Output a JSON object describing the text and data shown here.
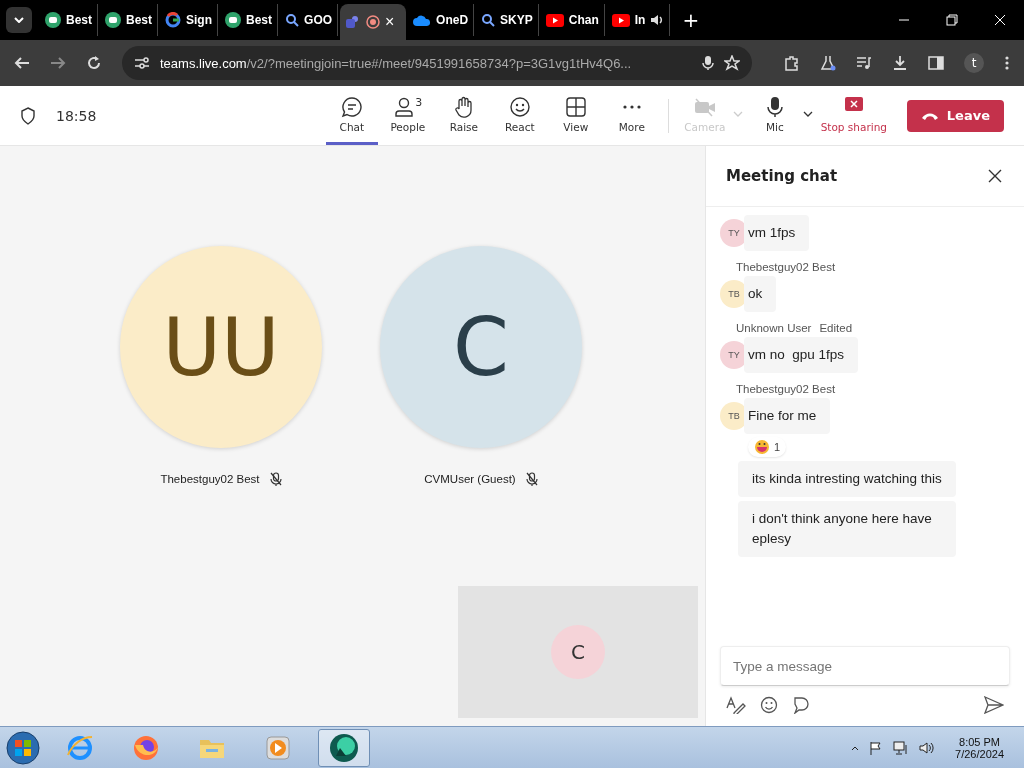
{
  "browser": {
    "tabs": [
      {
        "kind": "green",
        "label": "Best",
        "selected": false,
        "recording": false,
        "audio": false
      },
      {
        "kind": "green",
        "label": "Best",
        "selected": false,
        "recording": false,
        "audio": false
      },
      {
        "kind": "google",
        "label": "Sign",
        "selected": false,
        "recording": false,
        "audio": false
      },
      {
        "kind": "green",
        "label": "Best",
        "selected": false,
        "recording": false,
        "audio": false
      },
      {
        "kind": "search",
        "label": "GOO",
        "selected": false,
        "recording": false,
        "audio": false
      },
      {
        "kind": "teams",
        "selected": true,
        "recording": true,
        "audio": false,
        "close": "×"
      },
      {
        "kind": "cloud",
        "label": "OneD",
        "selected": false,
        "recording": false,
        "audio": false
      },
      {
        "kind": "search",
        "label": "SKYP",
        "selected": false,
        "recording": false,
        "audio": false
      },
      {
        "kind": "youtube",
        "label": "Chan",
        "selected": false,
        "recording": false,
        "audio": false
      },
      {
        "kind": "youtube",
        "label": "In",
        "selected": false,
        "recording": false,
        "audio": true
      }
    ],
    "new_tab": "+",
    "address": {
      "host": "teams.live.com",
      "path": "/v2/?meetingjoin=true#/meet/9451991658734?p=3G1vg1tHv4Q6..."
    },
    "profile": "t"
  },
  "meeting": {
    "time": "18:58",
    "toolbar": [
      {
        "kind": "chat",
        "label": "Chat",
        "selected": true,
        "disabled": false,
        "dropdown": false
      },
      {
        "kind": "people",
        "label": "People",
        "count": "3",
        "selected": false,
        "disabled": false,
        "dropdown": false
      },
      {
        "kind": "raise",
        "label": "Raise",
        "selected": false,
        "disabled": false,
        "dropdown": false
      },
      {
        "kind": "react",
        "label": "React",
        "selected": false,
        "disabled": false,
        "dropdown": false
      },
      {
        "kind": "view",
        "label": "View",
        "selected": false,
        "disabled": false,
        "dropdown": false
      },
      {
        "kind": "more",
        "label": "More",
        "selected": false,
        "disabled": false,
        "dropdown": false
      },
      {
        "kind": "camera",
        "label": "Camera",
        "selected": false,
        "disabled": true,
        "dropdown": true
      },
      {
        "kind": "mic",
        "label": "Mic",
        "selected": false,
        "disabled": false,
        "dropdown": true
      },
      {
        "kind": "stop",
        "label": "Stop sharing",
        "selected": false,
        "disabled": false,
        "dropdown": false
      }
    ],
    "leave": "Leave",
    "participants": [
      {
        "initials": "UU",
        "name": "Thebestguy02 Best",
        "color": "#fbecc8",
        "muted": true
      },
      {
        "initials": "C",
        "name": "CVMUser (Guest)",
        "color": "#d5e3ea",
        "muted": true
      }
    ],
    "self_view": {
      "initials": "C",
      "color": "#f5d3d8"
    }
  },
  "chat": {
    "title": "Meeting chat",
    "messages": [
      {
        "initials": "TY",
        "color": "#f5d3d8",
        "text": "vm 1fps"
      },
      {
        "sender": "Thebestguy02 Best",
        "initials": "TB",
        "color": "#fbecc8",
        "text": "ok"
      },
      {
        "sender": "Unknown User",
        "note": "Edited",
        "initials": "TY",
        "color": "#f5d3d8",
        "text": "vm no  gpu 1fps"
      },
      {
        "sender": "Thebestguy02 Best",
        "initials": "TB",
        "color": "#fbecc8",
        "text": "Fine for me",
        "reaction_count": "1"
      },
      {
        "text": "its kinda intresting watching this"
      },
      {
        "text": "i don't think anyone here have eplesy"
      }
    ],
    "input": {
      "placeholder": "Type a message"
    }
  },
  "taskbar": {
    "apps": [
      {
        "kind": "ie",
        "selected": false
      },
      {
        "kind": "firefox",
        "selected": false
      },
      {
        "kind": "folder",
        "selected": false
      },
      {
        "kind": "player",
        "selected": false
      },
      {
        "kind": "teams",
        "selected": true
      }
    ],
    "time": "8:05 PM",
    "date": "7/26/2024"
  }
}
